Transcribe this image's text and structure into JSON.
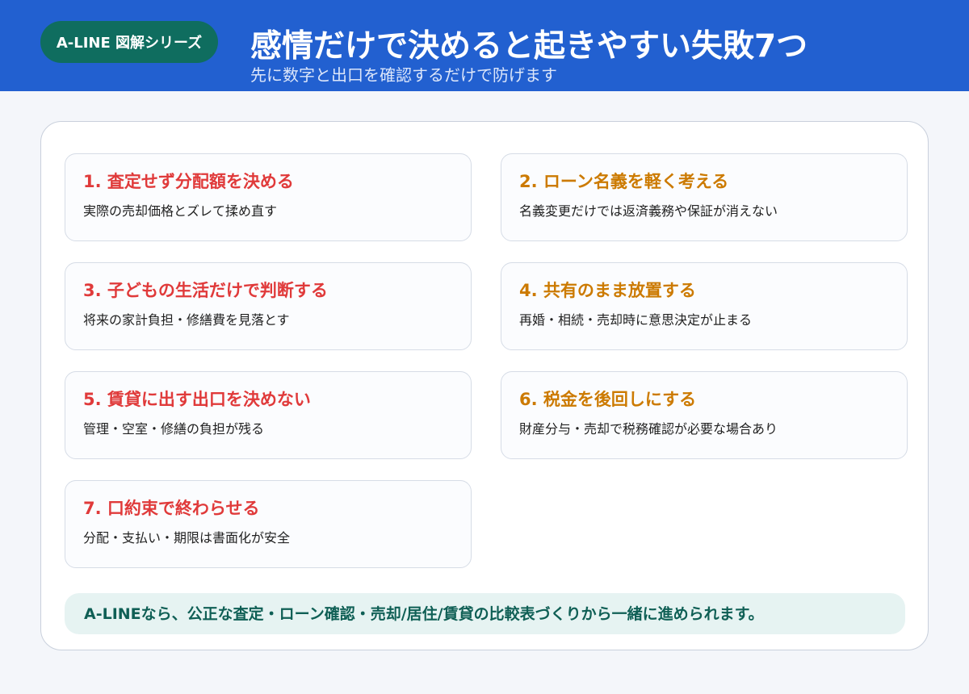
{
  "header": {
    "badge": "A-LINE 図解シリーズ",
    "title": "感情だけで決めると起きやすい失敗7つ",
    "subtitle": "先に数字と出口を確認するだけで防げます"
  },
  "items": [
    {
      "title": "1. 査定せず分配額を決める",
      "desc": "実際の売却価格とズレて揉め直す",
      "color": "#e03a3a"
    },
    {
      "title": "2. ローン名義を軽く考える",
      "desc": "名義変更だけでは返済義務や保証が消えない",
      "color": "#cc7a00"
    },
    {
      "title": "3. 子どもの生活だけで判断する",
      "desc": "将来の家計負担・修繕費を見落とす",
      "color": "#e03a3a"
    },
    {
      "title": "4. 共有のまま放置する",
      "desc": "再婚・相続・売却時に意思決定が止まる",
      "color": "#cc7a00"
    },
    {
      "title": "5. 賃貸に出す出口を決めない",
      "desc": "管理・空室・修繕の負担が残る",
      "color": "#e03a3a"
    },
    {
      "title": "6. 税金を後回しにする",
      "desc": "財産分与・売却で税務確認が必要な場合あり",
      "color": "#cc7a00"
    },
    {
      "title": "7. 口約束で終わらせる",
      "desc": "分配・支払い・期限は書面化が安全",
      "color": "#e03a3a"
    }
  ],
  "footer": {
    "text": "A-LINEなら、公正な査定・ローン確認・売却/居住/賃貸の比較表づくりから一緒に進められます。"
  }
}
